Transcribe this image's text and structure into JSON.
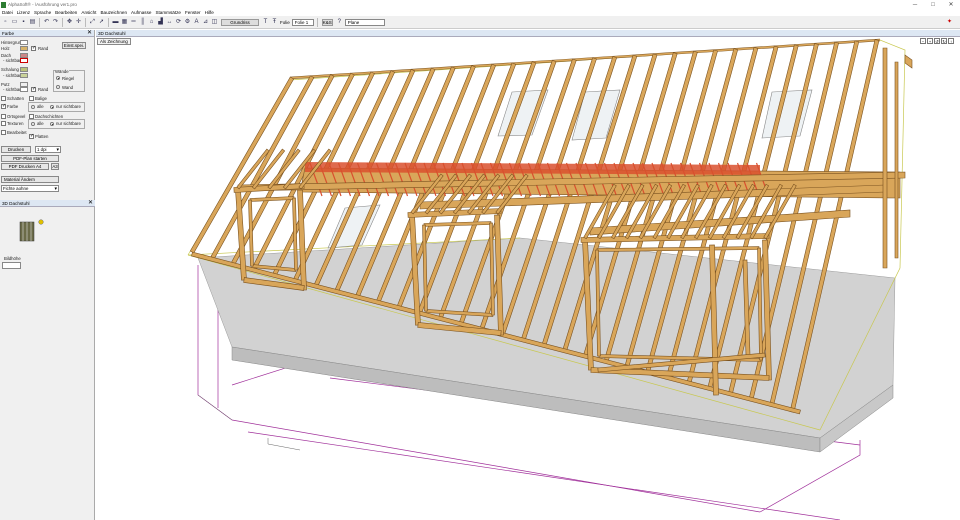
{
  "window": {
    "title": "AlphaSoft® - \\Ausführung ver1.pro"
  },
  "menu": [
    "Datei",
    "Lizenz",
    "Sprache",
    "Bearbeiten",
    "Ansicht",
    "Bauzeichnen",
    "Aufmasse",
    "Stammsätze",
    "Fenster",
    "Hilfe"
  ],
  "toolbar": {
    "scale_value": "Grundriss",
    "level_label": "Folie",
    "level_value": "Folie 1",
    "ok_label": "K&S",
    "layer_value": "Plane"
  },
  "farbe_panel": {
    "title": "Farbe",
    "rows": {
      "hintergrund": "Hintergrund",
      "holz": "Holz",
      "dach": "Dach",
      "dach_sichtbar": "- sichtbar",
      "schalung": "Schalung",
      "schalung_sichtbar": "- sichtbar",
      "putz": "Putz",
      "putz_sichtbar": "- sichtbar"
    },
    "rand1": "Rand",
    "rand2": "Rand",
    "einst_button": "Einst.spei.",
    "waende_label": "Wände",
    "waende_opt1": "Riegel",
    "waende_opt2": "Wand",
    "schatten": "Schatten",
    "balige": "Balige",
    "farbe": "Farbe",
    "alle1": "alle",
    "nur_sichtbare1": "nur sichtbare",
    "ortsgevel": "Ortsgevel",
    "dachschichten": "Dachschichten",
    "texturen": "Texturen",
    "alle2": "alle",
    "nur_sichtbare2": "nur sichtbare",
    "bearbeitet": "Bearbeitet",
    "platten": "Platten",
    "drucken_button": "Drucken",
    "dpi_value": "1 dpi",
    "pdf_plan_button": "PDF-Plan starten",
    "pdf_drucken_button": "PDF Drucken A4",
    "a3_button": "A3",
    "material_button": "Material Ändern",
    "material_value": "Fichte aohne"
  },
  "dachstuhl_panel": {
    "title": "3D Dachstuhl",
    "bildhoehe_label": "Bildhöhe"
  },
  "view": {
    "title": "3D Dachstuhl",
    "button": "Als Zeichnung"
  },
  "colors": {
    "wood": "#d9a65a",
    "wood_edge": "#7a5220",
    "batten": "#d9502e",
    "slab": "#cfcfcf",
    "wall_line": "#a0309a"
  }
}
